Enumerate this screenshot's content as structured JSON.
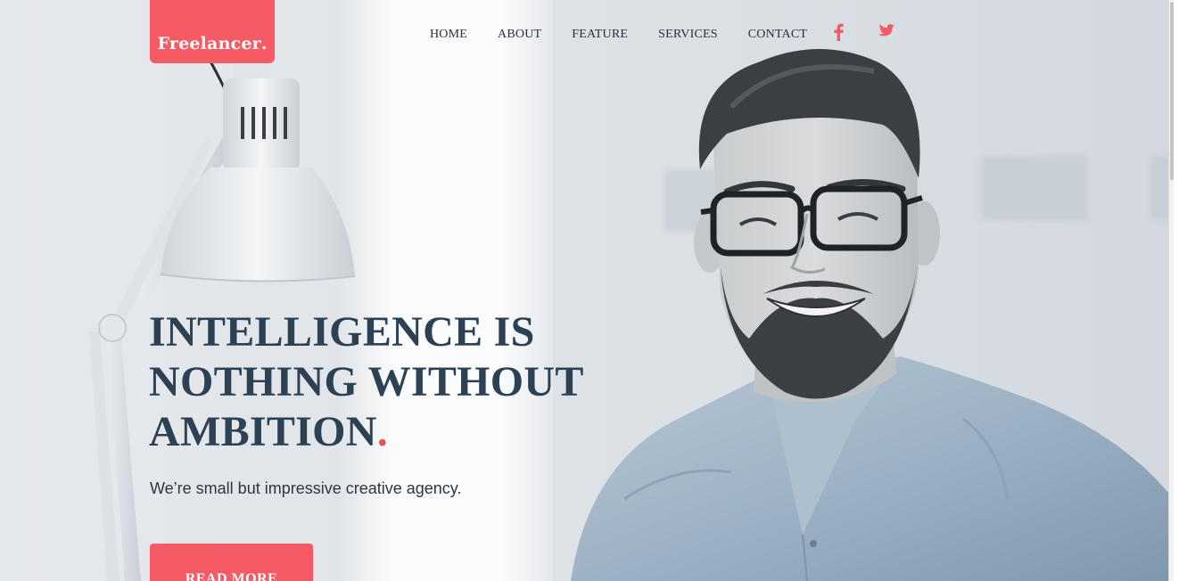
{
  "brand": {
    "name": "Freelancer",
    "dot": ".",
    "accent_color": "#f45b64"
  },
  "nav": {
    "items": [
      "HOME",
      "ABOUT",
      "FEATURE",
      "SERVICES",
      "CONTACT"
    ],
    "social": [
      {
        "icon": "facebook-icon",
        "glyph": "f"
      },
      {
        "icon": "twitter-icon"
      }
    ]
  },
  "hero": {
    "headline_line1": "INTELLIGENCE IS",
    "headline_line2": "NOTHING WITHOUT",
    "headline_line3": "AMBITION",
    "headline_dot": ".",
    "tagline": "We’re small but impressive creative agency.",
    "cta_label": "READ MORE",
    "headline_color": "#2d4154",
    "dot_color": "#f04e57"
  }
}
